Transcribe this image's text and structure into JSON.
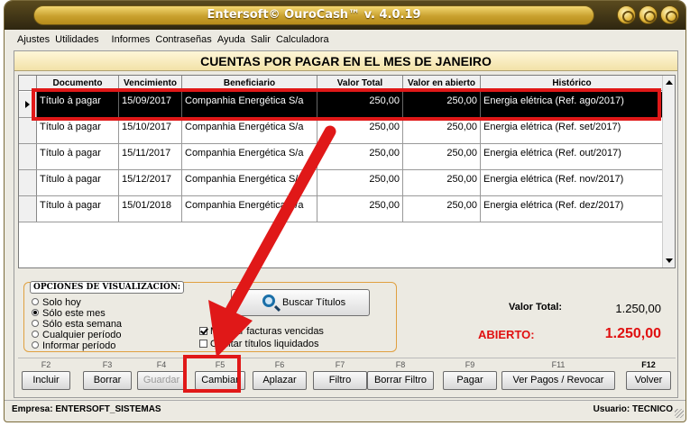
{
  "window": {
    "title": "Entersoft© OuroCash™ v. 4.0.19"
  },
  "menu": [
    "Ajustes",
    "Utilidades",
    "Informes",
    "Contraseñas",
    "Ayuda",
    "Salir",
    "Calculadora"
  ],
  "heading": "CUENTAS POR PAGAR EN EL MES DE JANEIRO",
  "table": {
    "columns": [
      "Documento",
      "Vencimiento",
      "Beneficiario",
      "Valor Total",
      "Valor en abierto",
      "Histórico"
    ],
    "rows": [
      [
        "Título à pagar",
        "15/09/2017",
        "Companhia Energética S/a",
        "250,00",
        "250,00",
        "Energia elétrica (Ref. ago/2017)"
      ],
      [
        "Título à pagar",
        "15/10/2017",
        "Companhia Energética S/a",
        "250,00",
        "250,00",
        "Energia elétrica (Ref. set/2017)"
      ],
      [
        "Título à pagar",
        "15/11/2017",
        "Companhia Energética S/a",
        "250,00",
        "250,00",
        "Energia elétrica (Ref. out/2017)"
      ],
      [
        "Título à pagar",
        "15/12/2017",
        "Companhia Energética S/a",
        "250,00",
        "250,00",
        "Energia elétrica (Ref. nov/2017)"
      ],
      [
        "Título à pagar",
        "15/01/2018",
        "Companhia Energética S/a",
        "250,00",
        "250,00",
        "Energia elétrica (Ref. dez/2017)"
      ]
    ],
    "selected_row": 0
  },
  "options": {
    "title": "OPCIONES DE VISUALIZACIÓN:",
    "radios": [
      "Solo hoy",
      "Sólo este mes",
      "Sólo esta semana",
      "Cualquier período",
      "Informar período"
    ],
    "selected": 1
  },
  "search_button": "Buscar Títulos",
  "checkboxes": {
    "show_overdue": {
      "label": "Mostrar facturas vencidas",
      "checked": true
    },
    "hide_paid": {
      "label": "Ocultar títulos liquidados",
      "checked": false
    }
  },
  "totals": {
    "total_label": "Valor Total:",
    "total_value": "1.250,00",
    "open_label": "ABIERTO:",
    "open_value": "1.250,00"
  },
  "function_keys": [
    {
      "key": "F2",
      "label": "Incluir"
    },
    {
      "key": "F3",
      "label": "Borrar"
    },
    {
      "key": "F4",
      "label": "Guardar",
      "disabled": true
    },
    {
      "key": "F5",
      "label": "Cambiar"
    },
    {
      "key": "F6",
      "label": "Aplazar"
    },
    {
      "key": "F7",
      "label": "Filtro"
    },
    {
      "key": "F8",
      "label": "Borrar Filtro"
    },
    {
      "key": "F9",
      "label": "Pagar"
    },
    {
      "key": "F11",
      "label": "Ver Pagos / Revocar"
    },
    {
      "key": "F12",
      "label": "Volver"
    }
  ],
  "status": {
    "empresa": "Empresa: ENTERSOFT_SISTEMAS",
    "usuario": "Usuario: TECNICO"
  },
  "colors": {
    "accent_gold": "#d8b040",
    "alert_red": "#e01010",
    "annotation_red": "#e01818",
    "selected_row_bg": "#000000"
  },
  "icons": {
    "search": "magnifier-icon",
    "window_buttons": [
      "minimize-icon",
      "maximize-icon",
      "close-icon"
    ]
  }
}
